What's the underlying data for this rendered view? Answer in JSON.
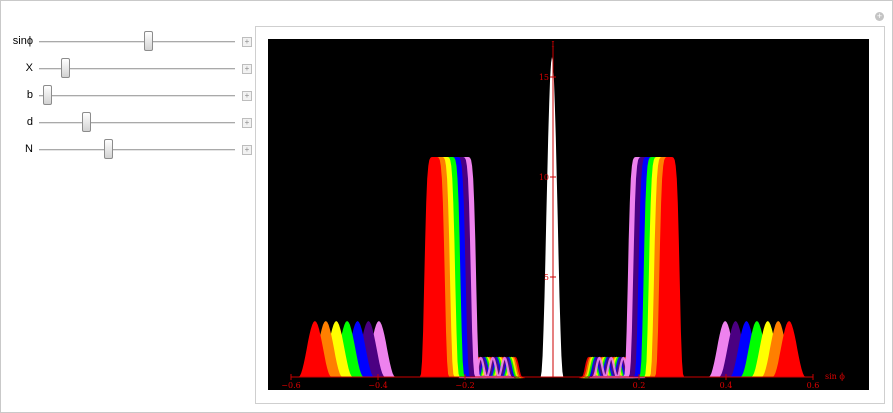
{
  "controls": [
    {
      "label": "sinϕ",
      "value": 0.56
    },
    {
      "label": "X",
      "value": 0.12
    },
    {
      "label": "b",
      "value": 0.02
    },
    {
      "label": "d",
      "value": 0.23
    },
    {
      "label": "N",
      "value": 0.35
    }
  ],
  "icons": {
    "corner": "plus-circle-icon",
    "increment": "plus-box-icon"
  },
  "chart_data": {
    "type": "line",
    "xlabel": "sin ϕ",
    "ylabel": "I",
    "xlim": [
      -0.6,
      0.6
    ],
    "ylim": [
      0,
      16.5
    ],
    "x_ticks": [
      "−0.6",
      "−0.4",
      "−0.2",
      "0.2",
      "0.4",
      "0.6"
    ],
    "y_ticks": [
      "5",
      "10",
      "15"
    ],
    "background": "#000000",
    "axis_color": "#cc0000",
    "grid": false,
    "central_peak": {
      "x": 0,
      "height": 16,
      "half_width": 0.026,
      "color": "#ffffff"
    },
    "series": [
      {
        "color": "#ff0000",
        "first_order_x": 0.27,
        "first_order_height": 11,
        "outer_x": 0.545,
        "outer_height": 2.8
      },
      {
        "color": "#ff7f00",
        "first_order_x": 0.258,
        "first_order_height": 11,
        "outer_x": 0.52,
        "outer_height": 2.8
      },
      {
        "color": "#ffff00",
        "first_order_x": 0.246,
        "first_order_height": 11,
        "outer_x": 0.496,
        "outer_height": 2.8
      },
      {
        "color": "#00ff00",
        "first_order_x": 0.234,
        "first_order_height": 11,
        "outer_x": 0.471,
        "outer_height": 2.8
      },
      {
        "color": "#0000ff",
        "first_order_x": 0.222,
        "first_order_height": 11,
        "outer_x": 0.447,
        "outer_height": 2.8
      },
      {
        "color": "#4b0082",
        "first_order_x": 0.21,
        "first_order_height": 11,
        "outer_x": 0.422,
        "outer_height": 2.8
      },
      {
        "color": "#ee82ee",
        "first_order_x": 0.198,
        "first_order_height": 11,
        "outer_x": 0.398,
        "outer_height": 2.8
      }
    ]
  }
}
